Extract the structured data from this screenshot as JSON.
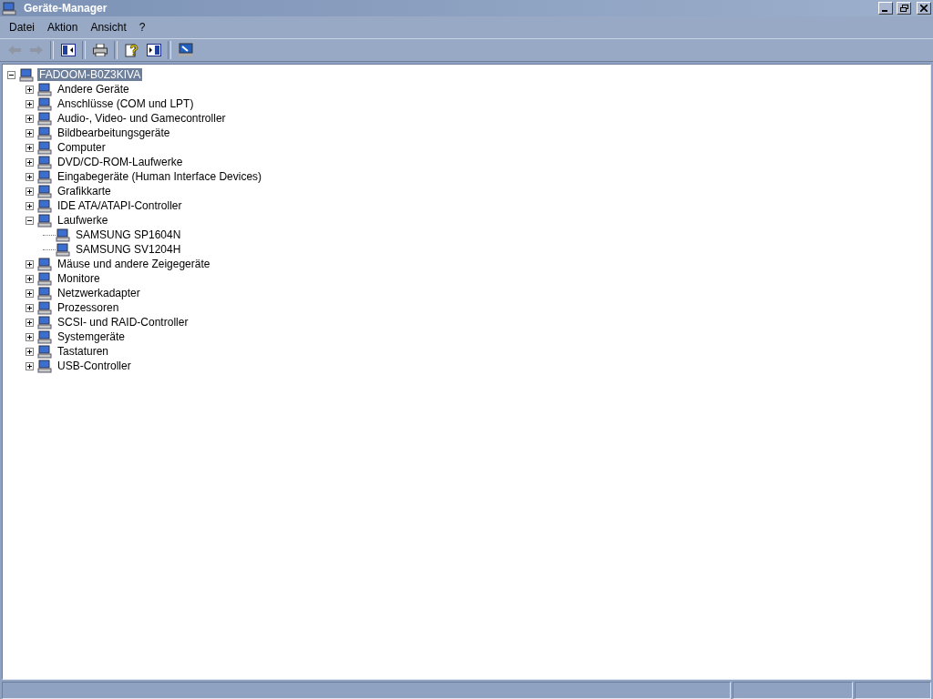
{
  "window": {
    "title": "Geräte-Manager"
  },
  "menu": [
    "Datei",
    "Aktion",
    "Ansicht",
    "?"
  ],
  "toolbar": [
    {
      "kind": "back",
      "disabled": true
    },
    {
      "kind": "forward",
      "disabled": true
    },
    {
      "kind": "sep"
    },
    {
      "kind": "panel",
      "disabled": false
    },
    {
      "kind": "sep"
    },
    {
      "kind": "print",
      "disabled": false
    },
    {
      "kind": "sep"
    },
    {
      "kind": "help",
      "disabled": false
    },
    {
      "kind": "panel2",
      "disabled": false
    },
    {
      "kind": "sep"
    },
    {
      "kind": "scan",
      "disabled": false
    }
  ],
  "tree": [
    {
      "label": "FADOOM-B0Z3KIVA",
      "selected": true,
      "expanded": true,
      "children": [
        {
          "label": "Andere Geräte",
          "selected": false,
          "expanded": false
        },
        {
          "label": "Anschlüsse (COM und LPT)",
          "selected": false,
          "expanded": false
        },
        {
          "label": "Audio-, Video- und Gamecontroller",
          "selected": false,
          "expanded": false
        },
        {
          "label": "Bildbearbeitungsgeräte",
          "selected": false,
          "expanded": false
        },
        {
          "label": "Computer",
          "selected": false,
          "expanded": false
        },
        {
          "label": "DVD/CD-ROM-Laufwerke",
          "selected": false,
          "expanded": false
        },
        {
          "label": "Eingabegeräte (Human Interface Devices)",
          "selected": false,
          "expanded": false
        },
        {
          "label": "Grafikkarte",
          "selected": false,
          "expanded": false
        },
        {
          "label": "IDE ATA/ATAPI-Controller",
          "selected": false,
          "expanded": false
        },
        {
          "label": "Laufwerke",
          "selected": false,
          "expanded": true,
          "children": [
            {
              "label": "SAMSUNG SP1604N",
              "selected": false
            },
            {
              "label": "SAMSUNG SV1204H",
              "selected": false
            }
          ]
        },
        {
          "label": "Mäuse und andere Zeigegeräte",
          "selected": false,
          "expanded": false
        },
        {
          "label": "Monitore",
          "selected": false,
          "expanded": false
        },
        {
          "label": "Netzwerkadapter",
          "selected": false,
          "expanded": false
        },
        {
          "label": "Prozessoren",
          "selected": false,
          "expanded": false
        },
        {
          "label": "SCSI- und RAID-Controller",
          "selected": false,
          "expanded": false
        },
        {
          "label": "Systemgeräte",
          "selected": false,
          "expanded": false
        },
        {
          "label": "Tastaturen",
          "selected": false,
          "expanded": false
        },
        {
          "label": "USB-Controller",
          "selected": false,
          "expanded": false
        }
      ]
    }
  ]
}
